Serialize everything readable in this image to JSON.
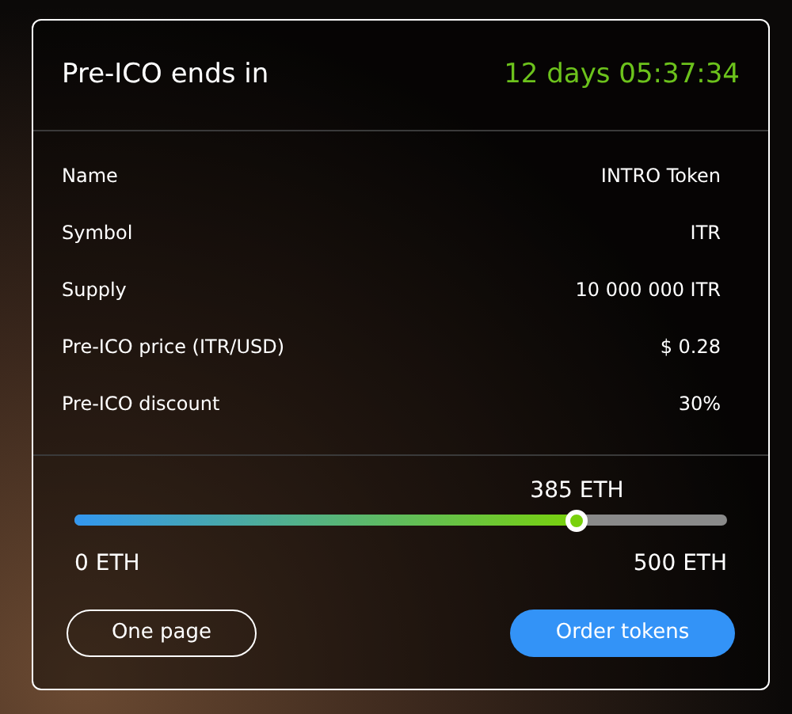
{
  "header": {
    "title": "Pre-ICO ends in",
    "countdown": "12 days 05:37:34"
  },
  "details": [
    {
      "label": "Name",
      "value": "INTRO Token"
    },
    {
      "label": "Symbol",
      "value": "ITR"
    },
    {
      "label": "Supply",
      "value": "10 000 000 ITR"
    },
    {
      "label": "Pre-ICO price (ITR/USD)",
      "value": "$ 0.28"
    },
    {
      "label": "Pre-ICO discount",
      "value": "30%"
    }
  ],
  "progress": {
    "current": "385 ETH",
    "level": 0.77,
    "min": "0 ETH",
    "max": "500 ETH"
  },
  "buttons": [
    {
      "label": "One page",
      "kind": "outline"
    },
    {
      "label": "Order tokens",
      "kind": "primary"
    }
  ]
}
